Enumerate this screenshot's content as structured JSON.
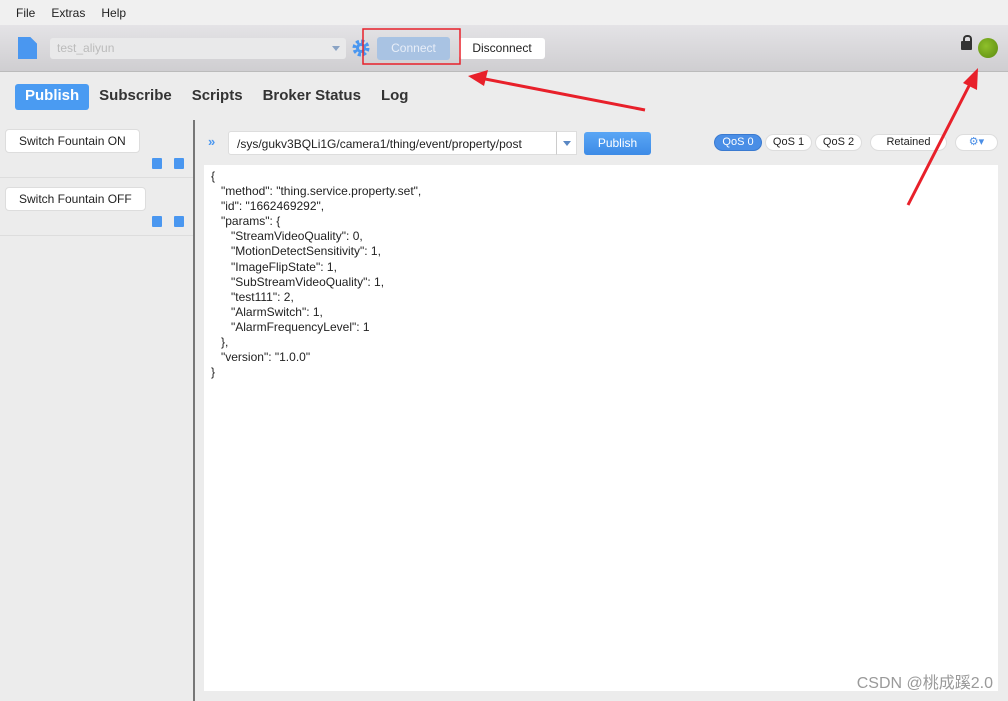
{
  "menu": [
    "File",
    "Extras",
    "Help"
  ],
  "toolbar": {
    "profile": "test_aliyun",
    "connect": "Connect",
    "disconnect": "Disconnect",
    "status_color": "#7aad1e"
  },
  "tabs": [
    "Publish",
    "Subscribe",
    "Scripts",
    "Broker Status",
    "Log"
  ],
  "scripts": [
    "Switch Fountain ON",
    "Switch Fountain OFF"
  ],
  "publish": {
    "topic": "/sys/gukv3BQLi1G/camera1/thing/event/property/post",
    "button": "Publish",
    "qos": [
      "QoS 0",
      "QoS 1",
      "QoS 2"
    ],
    "selected_qos": "QoS 0",
    "retained": "Retained"
  },
  "payload": [
    "{",
    "   \"method\": \"thing.service.property.set\",",
    "   \"id\": \"1662469292\",",
    "   \"params\": {",
    "      \"StreamVideoQuality\": 0,",
    "      \"MotionDetectSensitivity\": 1,",
    "      \"ImageFlipState\": 1,",
    "      \"SubStreamVideoQuality\": 1,",
    "      \"test111\": 2,",
    "      \"AlarmSwitch\": 1,",
    "      \"AlarmFrequencyLevel\": 1",
    "   },",
    "   \"version\": \"1.0.0\"",
    "}"
  ],
  "watermark": "CSDN @桃成蹊2.0",
  "annotation_color": "#e8202a"
}
